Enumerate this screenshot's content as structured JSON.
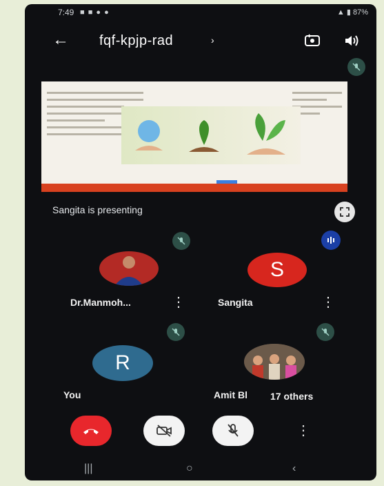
{
  "statusbar": {
    "time": "7:49",
    "left_icons": "■ ■ ● ●",
    "right_icons": "▲ ▮ 87%"
  },
  "header": {
    "title": "fqf-kpjp-rad"
  },
  "presentation": {
    "presenting_label": "Sangita is presenting"
  },
  "participants": [
    {
      "name": "Dr.Manmoh...",
      "avatar": "photo",
      "muted": true
    },
    {
      "name": "Sangita",
      "initial": "S",
      "avatar_color": "#d7261e",
      "muted": false,
      "speaking": true
    },
    {
      "name": "You",
      "initial": "R",
      "avatar_color": "#2f6b8f",
      "muted": true
    },
    {
      "name": "Amit Bl",
      "avatar": "photo",
      "muted": true,
      "others_label": "17 others"
    }
  ],
  "colors": {
    "end_call": "#e8272c",
    "control_bg": "#f3f3f3",
    "mute_badge": "#2d4f47",
    "speaking_badge": "#1b3fa6"
  },
  "icons": [
    "back-arrow-icon",
    "switch-camera-icon",
    "speaker-icon",
    "mic-off-icon",
    "fullscreen-icon",
    "more-vert-icon",
    "end-call-icon",
    "video-off-icon"
  ]
}
